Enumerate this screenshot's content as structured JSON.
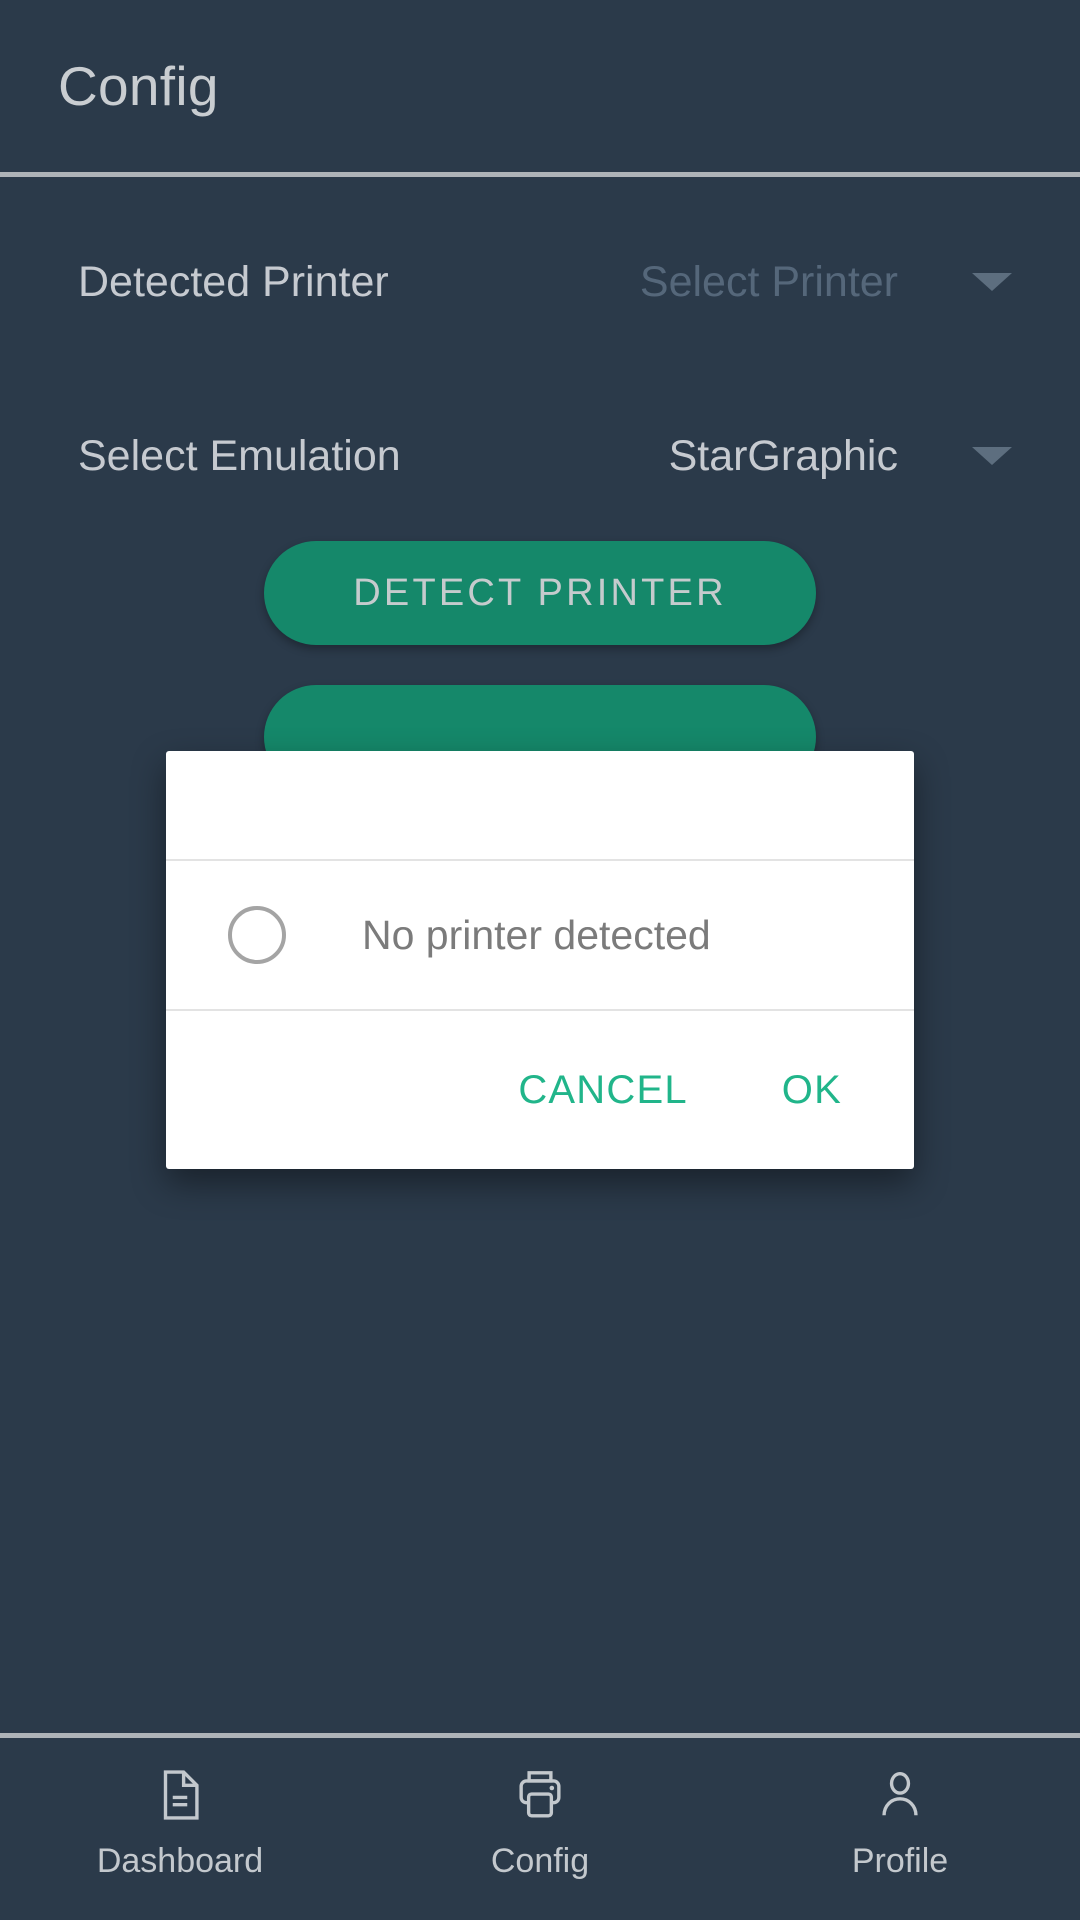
{
  "header": {
    "title": "Config"
  },
  "form": {
    "rows": [
      {
        "label": "Detected Printer",
        "value": "Select Printer",
        "state": "placeholder",
        "caret": "chevron-down-icon"
      },
      {
        "label": "Select Emulation",
        "value": "StarGraphic",
        "state": "selected",
        "caret": "chevron-down-icon"
      }
    ]
  },
  "actions": {
    "detect_printer": "DETECT PRINTER",
    "secondary_button": ""
  },
  "dialog": {
    "title": "",
    "option_label": "No printer detected",
    "radio_selected": false,
    "cancel_label": "CANCEL",
    "ok_label": "OK"
  },
  "bottom_nav": {
    "items": [
      {
        "label": "Dashboard",
        "icon": "document-icon"
      },
      {
        "label": "Config",
        "icon": "printer-icon"
      },
      {
        "label": "Profile",
        "icon": "person-icon"
      }
    ]
  },
  "colors": {
    "background": "#2b3a4a",
    "accent_green": "#15886a",
    "dialog_accent": "#21b58a",
    "divider": "#aeb3b8",
    "text_primary": "#c6cad0",
    "text_muted": "#55677a"
  }
}
